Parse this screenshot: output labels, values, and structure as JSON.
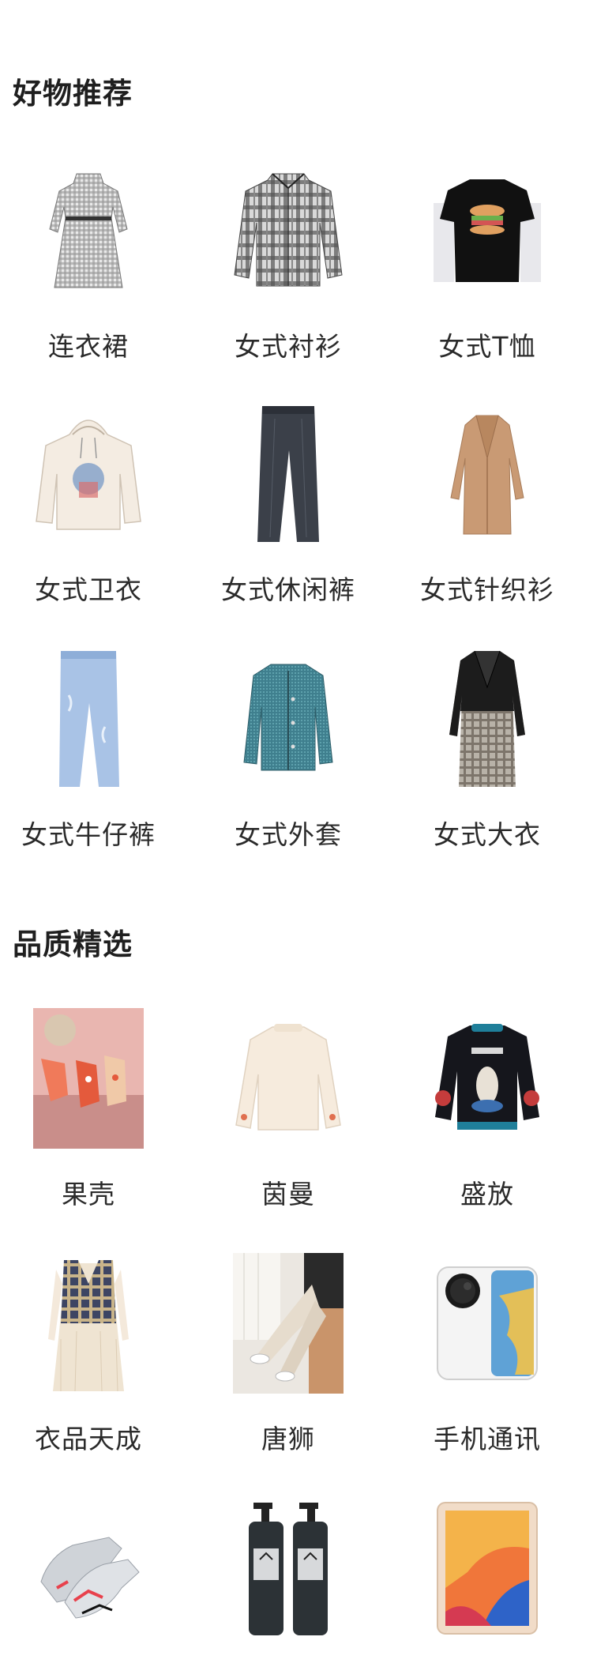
{
  "sections": [
    {
      "title": "好物推荐",
      "items": [
        {
          "label": "连衣裙",
          "icon": "dress-icon"
        },
        {
          "label": "女式衬衫",
          "icon": "plaid-shirt-icon"
        },
        {
          "label": "女式T恤",
          "icon": "tshirt-icon"
        },
        {
          "label": "女式卫衣",
          "icon": "hoodie-icon"
        },
        {
          "label": "女式休闲裤",
          "icon": "trousers-icon"
        },
        {
          "label": "女式针织衫",
          "icon": "cardigan-icon"
        },
        {
          "label": "女式牛仔裤",
          "icon": "jeans-icon"
        },
        {
          "label": "女式外套",
          "icon": "jacket-icon"
        },
        {
          "label": "女式大衣",
          "icon": "coat-icon"
        }
      ]
    },
    {
      "title": "品质精选",
      "items": [
        {
          "label": "果壳",
          "icon": "socks-photo-icon"
        },
        {
          "label": "茵曼",
          "icon": "sweater-icon"
        },
        {
          "label": "盛放",
          "icon": "graphic-sweater-icon"
        },
        {
          "label": "衣品天成",
          "icon": "vest-dress-icon"
        },
        {
          "label": "唐狮",
          "icon": "pants-photo-icon"
        },
        {
          "label": "手机通讯",
          "icon": "smartphone-icon"
        },
        {
          "label": "",
          "icon": "sneakers-icon"
        },
        {
          "label": "",
          "icon": "shampoo-bottles-icon"
        },
        {
          "label": "",
          "icon": "tablet-icon"
        }
      ]
    }
  ]
}
